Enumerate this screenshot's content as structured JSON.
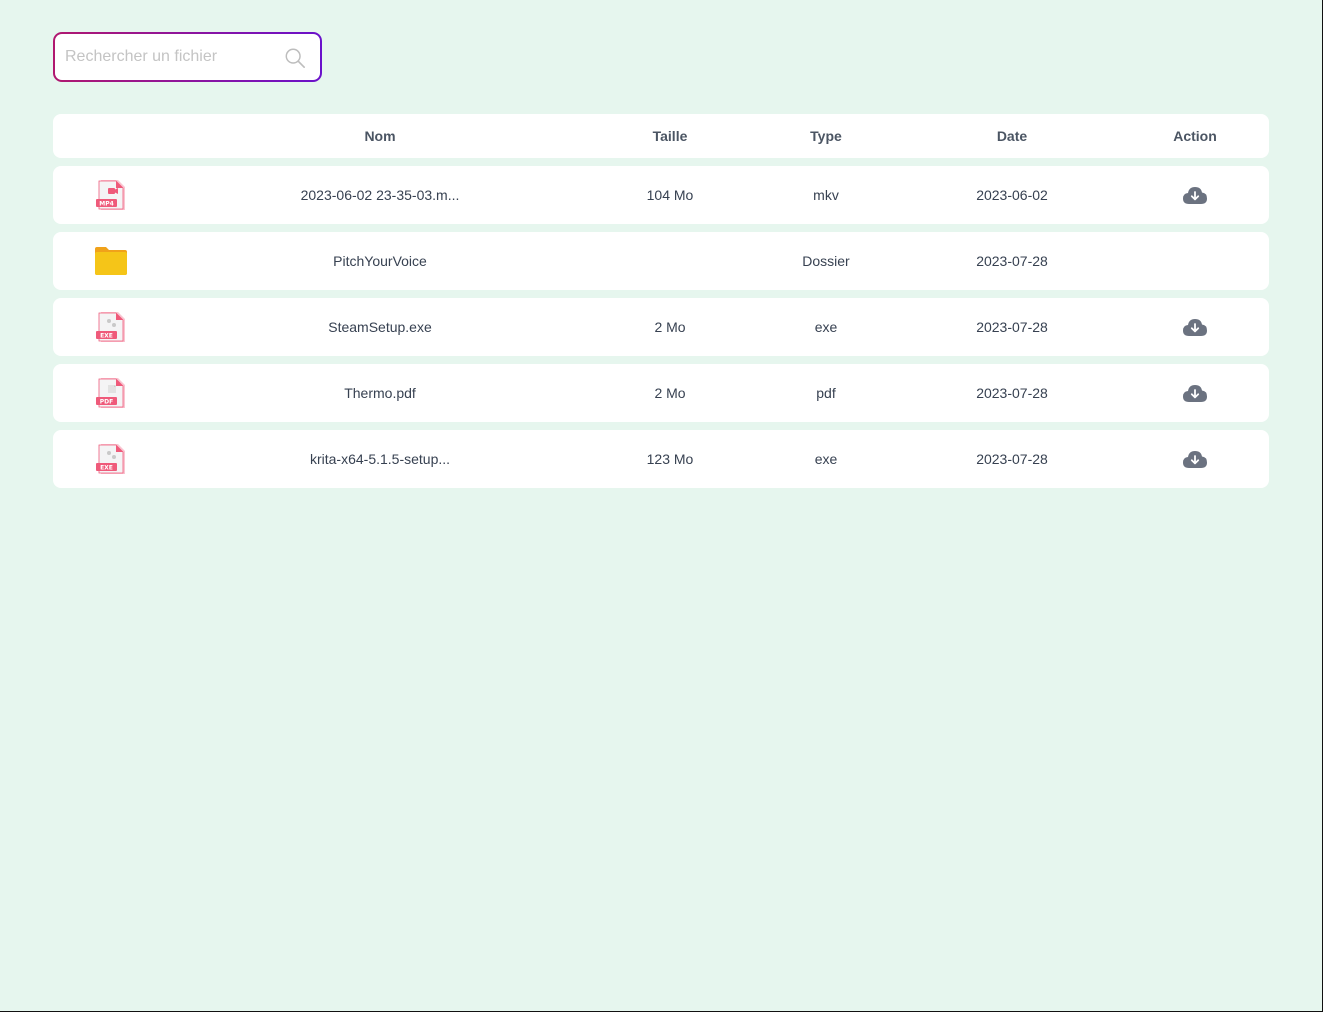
{
  "search": {
    "placeholder": "Rechercher un fichier",
    "value": ""
  },
  "table": {
    "headers": {
      "name": "Nom",
      "size": "Taille",
      "type": "Type",
      "date": "Date",
      "action": "Action"
    },
    "rows": [
      {
        "icon": "mp4-file-icon",
        "icon_label": "MP4",
        "name": "2023-06-02 23-35-03.m...",
        "size": "104 Mo",
        "type": "mkv",
        "date": "2023-06-02",
        "download": true
      },
      {
        "icon": "folder-icon",
        "icon_label": "",
        "name": "PitchYourVoice",
        "size": "",
        "type": "Dossier",
        "date": "2023-07-28",
        "download": false
      },
      {
        "icon": "exe-file-icon",
        "icon_label": "EXE",
        "name": "SteamSetup.exe",
        "size": "2 Mo",
        "type": "exe",
        "date": "2023-07-28",
        "download": true
      },
      {
        "icon": "pdf-file-icon",
        "icon_label": "PDF",
        "name": "Thermo.pdf",
        "size": "2 Mo",
        "type": "pdf",
        "date": "2023-07-28",
        "download": true
      },
      {
        "icon": "exe-file-icon",
        "icon_label": "EXE",
        "name": "krita-x64-5.1.5-setup...",
        "size": "123 Mo",
        "type": "exe",
        "date": "2023-07-28",
        "download": true
      }
    ]
  },
  "colors": {
    "background": "#e6f6ee",
    "search_border_start": "#b0186f",
    "search_border_end": "#6a11cb",
    "file_icon_red": "#ef5a7a",
    "folder_yellow": "#f5c518",
    "download_gray": "#6b7280"
  }
}
